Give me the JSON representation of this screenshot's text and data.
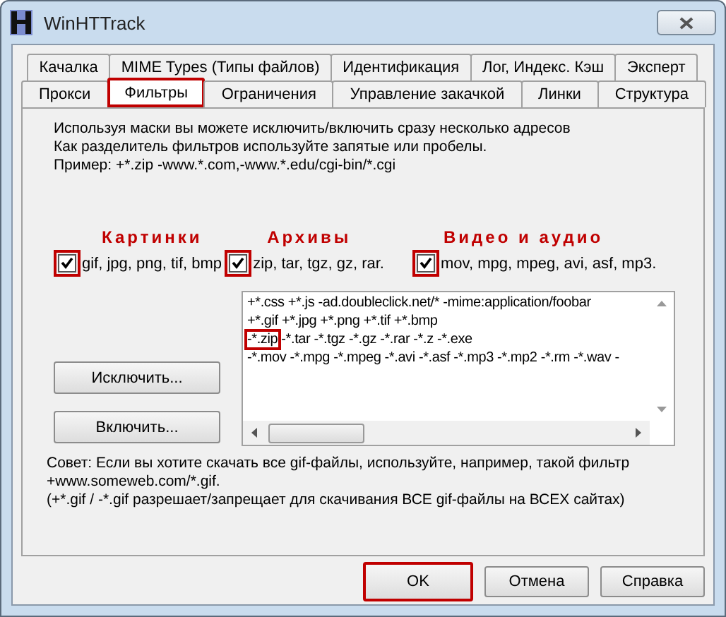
{
  "window": {
    "title": "WinHTTrack"
  },
  "tab_rows": [
    [
      {
        "label": "Качалка",
        "selected": false,
        "highlighted": false
      },
      {
        "label": "MIME Types (Типы файлов)",
        "selected": false,
        "highlighted": false
      },
      {
        "label": "Идентификация",
        "selected": false,
        "highlighted": false
      },
      {
        "label": "Лог, Индекс. Кэш",
        "selected": false,
        "highlighted": false
      },
      {
        "label": "Эксперт",
        "selected": false,
        "highlighted": false
      }
    ],
    [
      {
        "label": "Прокси",
        "selected": false,
        "highlighted": false
      },
      {
        "label": "Фильтры",
        "selected": true,
        "highlighted": true
      },
      {
        "label": "Ограничения",
        "selected": false,
        "highlighted": false
      },
      {
        "label": "Управление закачкой",
        "selected": false,
        "highlighted": false
      },
      {
        "label": "Линки",
        "selected": false,
        "highlighted": false
      },
      {
        "label": "Структура",
        "selected": false,
        "highlighted": false
      }
    ]
  ],
  "intro": [
    "Используя маски вы можете исключить/включить сразу несколько адресов",
    "Как разделитель фильтров используйте запятые или пробелы.",
    "Пример: +*.zip -www.*.com,-www.*.edu/cgi-bin/*.cgi"
  ],
  "presets": [
    {
      "annotation": "Картинки",
      "label": "gif, jpg, png, tif, bmp",
      "checked": true,
      "highlighted": true
    },
    {
      "annotation": "Архивы",
      "label": "zip, tar, tgz, gz, rar.",
      "checked": true,
      "highlighted": true
    },
    {
      "annotation": "Видео и аудио",
      "label": "mov, mpg, mpeg, avi, asf, mp3.",
      "checked": true,
      "highlighted": true
    }
  ],
  "buttons_side": [
    "Исключить...",
    "Включить..."
  ],
  "filters": [
    [
      {
        "text": "+*.css +*.js -ad.doubleclick.net/* -mime:application/foobar",
        "highlighted": false
      }
    ],
    [
      {
        "text": "+*.gif +*.jpg +*.png +*.tif +*.bmp",
        "highlighted": false
      }
    ],
    [
      {
        "text": "-*.zip",
        "highlighted": true
      },
      {
        "text": " -*.tar -*.tgz -*.gz -*.rar -*.z -*.exe",
        "highlighted": false
      }
    ],
    [
      {
        "text": "-*.mov -*.mpg -*.mpeg -*.avi -*.asf -*.mp3 -*.mp2 -*.rm -*.wav -",
        "highlighted": false
      }
    ]
  ],
  "hint": [
    "Совет: Если вы хотите скачать все gif-файлы, используйте, например, такой фильтр",
    "+www.someweb.com/*.gif.",
    "(+*.gif / -*.gif разрешает/запрещает для скачивания ВСЕ gif-файлы на ВСЕХ сайтах)"
  ],
  "footer_buttons": [
    {
      "label": "OK",
      "highlighted": true
    },
    {
      "label": "Отмена",
      "highlighted": false
    },
    {
      "label": "Справка",
      "highlighted": false
    }
  ]
}
